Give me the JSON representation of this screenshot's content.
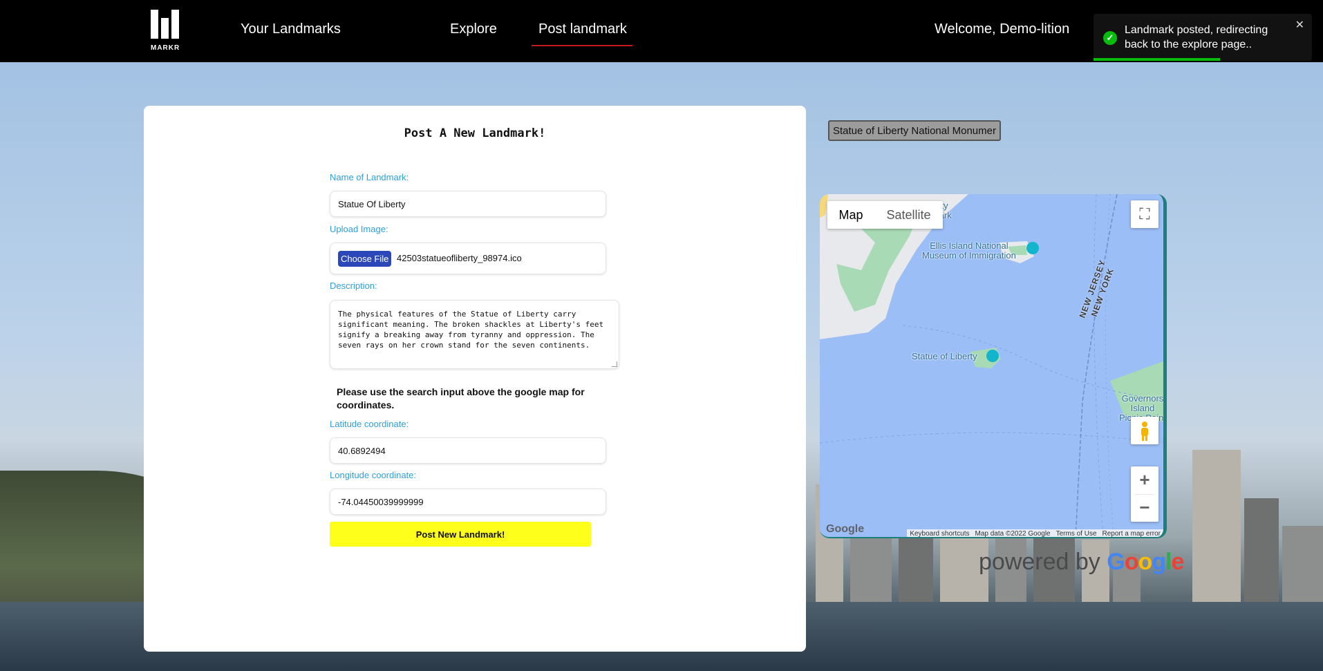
{
  "nav": {
    "logo_text": "MARKR",
    "your_landmarks": "Your Landmarks",
    "explore": "Explore",
    "post_landmark": "Post landmark",
    "welcome": "Welcome, Demo-lition"
  },
  "toast": {
    "message": "Landmark posted, redirecting back to the explore page..",
    "close": "✕",
    "progress": 0.58
  },
  "form": {
    "title": "Post A New Landmark!",
    "name_label": "Name of Landmark:",
    "name_value": "Statue Of Liberty",
    "image_label": "Upload Image:",
    "file_button": "Choose File",
    "file_name": "42503statueofliberty_98974.ico",
    "description_label": "Description:",
    "description_value": "The physical features of the Statue of Liberty carry significant meaning. The broken shackles at Liberty's feet signify a breaking away from tyranny and oppression. The seven rays on her crown stand for the seven continents.",
    "note": "Please use the search input above the google map for coordinates.",
    "lat_label": "Latitude coordinate:",
    "lat_value": "40.6892494",
    "lng_label": "Longitude coordinate:",
    "lng_value": "-74.04450039999999",
    "submit": "Post New Landmark!"
  },
  "map": {
    "search_value": "Statue of Liberty National Monumer",
    "type_map": "Map",
    "type_satellite": "Satellite",
    "labels": {
      "liberty_park": "erty\nPark",
      "ellis": "Ellis Island National\nMuseum of Immigration",
      "statue": "Statue of Liberty",
      "governors": "Governors\nIsland\nPicnic Point",
      "nj": "NEW JERSEY",
      "ny": "NEW YORK"
    },
    "google_mark": "Google",
    "attribution": [
      "Keyboard shortcuts",
      "Map data ©2022 Google",
      "Terms of Use",
      "Report a map error"
    ]
  },
  "powered_by": {
    "prefix": "powered by",
    "brand": "Google"
  },
  "colors": {
    "accent_label": "#2d9fd9",
    "submit_bg": "#ffff1c",
    "nav_underline": "#c21b1b",
    "toast_success": "#07bc0c"
  },
  "icons": {
    "toast": "check-circle-icon",
    "fullscreen": "fullscreen-icon",
    "pegman": "pegman-icon",
    "zoom_in": "plus-icon",
    "zoom_out": "minus-icon"
  }
}
